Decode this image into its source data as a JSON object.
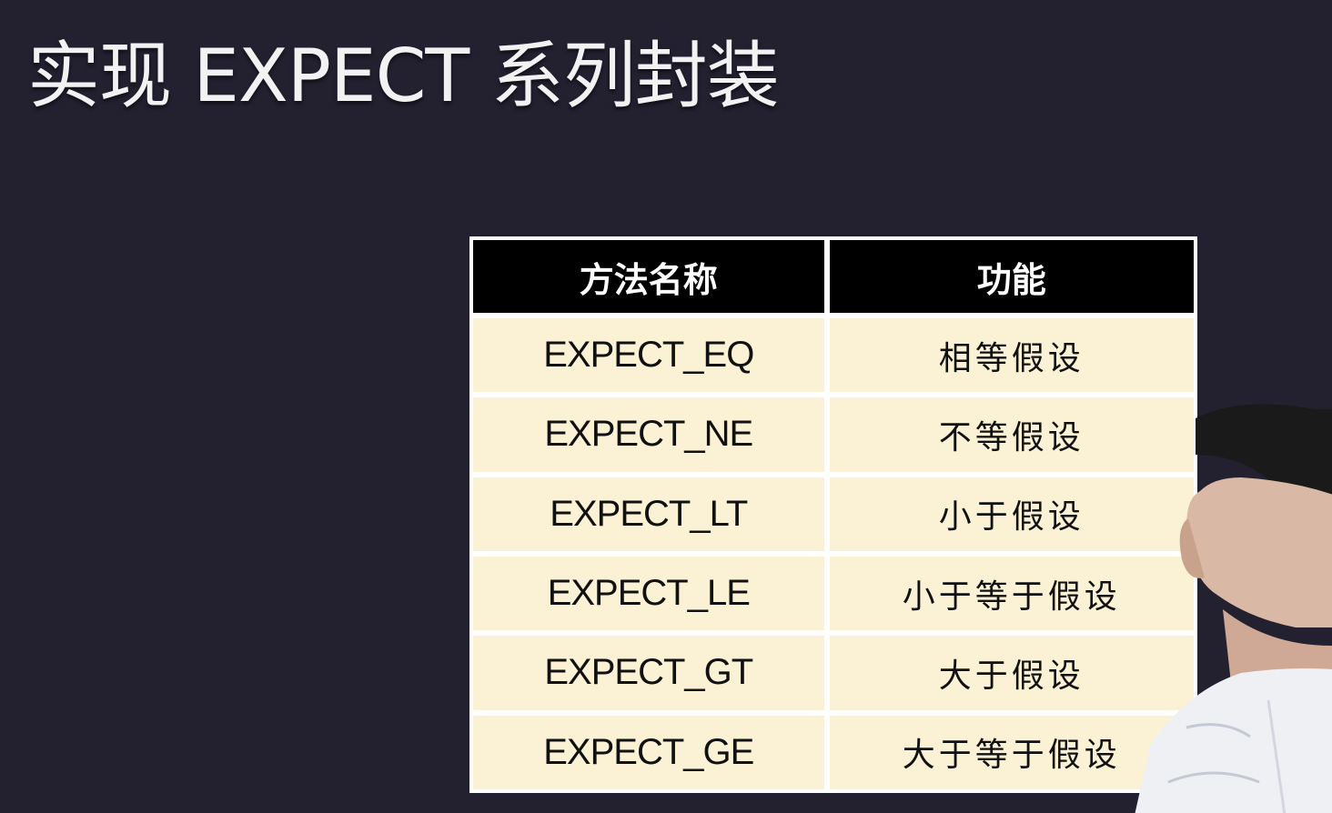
{
  "slide": {
    "title": "实现 EXPECT 系列封装"
  },
  "table": {
    "headers": [
      "方法名称",
      "功能"
    ],
    "rows": [
      {
        "method": "EXPECT_EQ",
        "function": "相等假设"
      },
      {
        "method": "EXPECT_NE",
        "function": "不等假设"
      },
      {
        "method": "EXPECT_LT",
        "function": "小于假设"
      },
      {
        "method": "EXPECT_LE",
        "function": "小于等于假设"
      },
      {
        "method": "EXPECT_GT",
        "function": "大于假设"
      },
      {
        "method": "EXPECT_GE",
        "function": "大于等于假设"
      }
    ]
  },
  "colors": {
    "background": "#232030",
    "header_bg": "#000000",
    "cell_bg": "#fbf2d5",
    "table_border": "#ffffff"
  }
}
